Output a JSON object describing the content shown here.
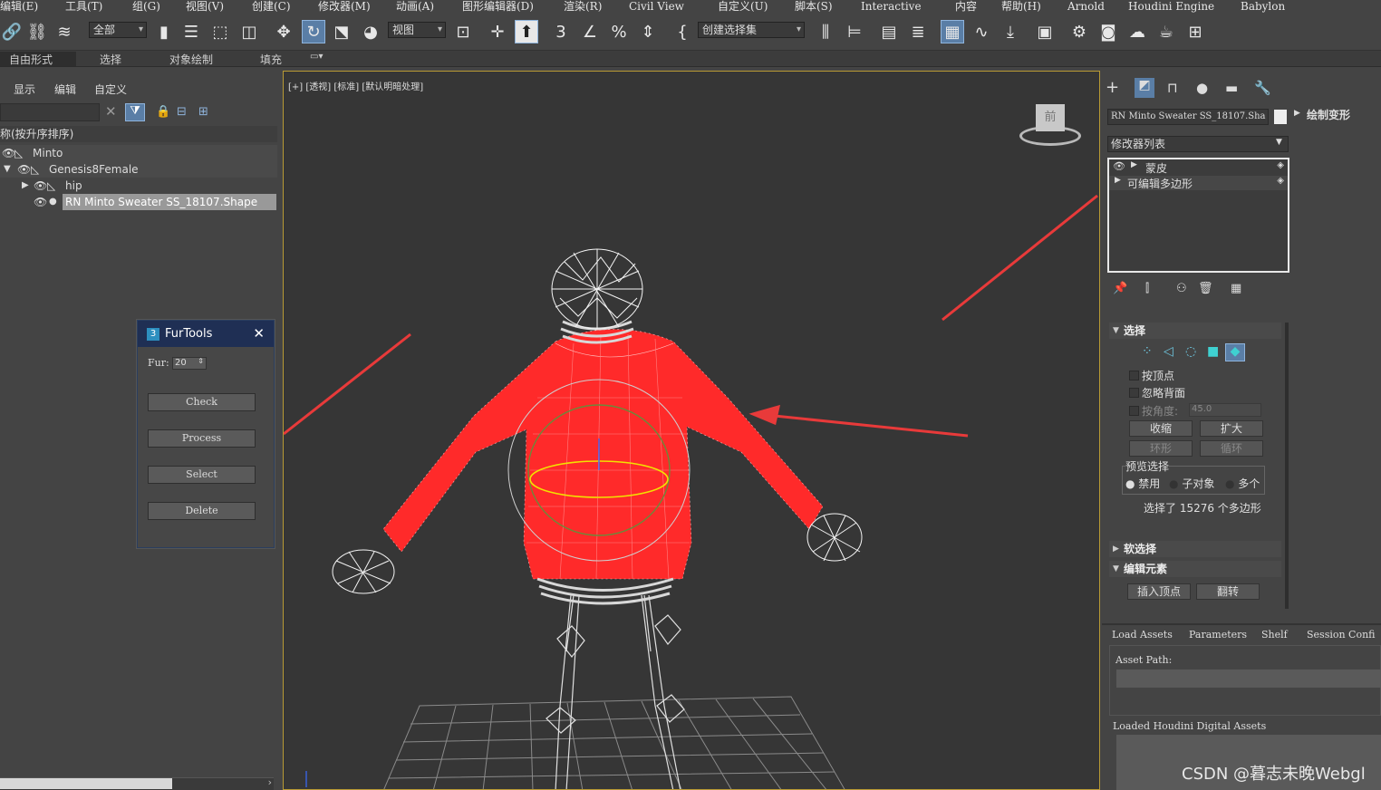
{
  "menu": [
    "编辑(E)",
    "工具(T)",
    "组(G)",
    "视图(V)",
    "创建(C)",
    "修改器(M)",
    "动画(A)",
    "图形编辑器(D)",
    "渲染(R)",
    "Civil View",
    "自定义(U)",
    "脚本(S)",
    "Interactive",
    "内容",
    "帮助(H)",
    "Arnold",
    "Houdini Engine",
    "Babylon"
  ],
  "toolbar": {
    "selection_filter": "全部",
    "ref_coord": "视图",
    "named_selection": "创建选择集"
  },
  "ribbon": [
    "自由形式",
    "选择",
    "对象绘制",
    "填充"
  ],
  "scene_explorer": {
    "tabs": [
      "显示",
      "编辑",
      "自定义"
    ],
    "sort_header": "称(按升序排序)",
    "items": [
      {
        "name": "Minto"
      },
      {
        "name": "Genesis8Female"
      },
      {
        "name": "hip"
      },
      {
        "name": "RN Minto Sweater SS_18107.Shape"
      }
    ]
  },
  "viewport": {
    "label": "[+] [透视] [标准] [默认明暗处理]",
    "viewcube_label": "前"
  },
  "furtools": {
    "title": "FurTools",
    "fur_label": "Fur:",
    "fur_value": "20",
    "buttons": [
      "Check",
      "Process",
      "Select",
      "Delete"
    ]
  },
  "command_panel": {
    "object_name": "RN Minto Sweater SS_18107.Sha",
    "modifier_list": "修改器列表",
    "stack": [
      "蒙皮",
      "可编辑多边形"
    ],
    "paint_deform": "绘制变形",
    "selection": {
      "title": "选择",
      "by_vertex": "按顶点",
      "ignore_backfacing": "忽略背面",
      "by_angle": "按角度:",
      "angle_value": "45.0",
      "shrink": "收缩",
      "grow": "扩大",
      "ring": "环形",
      "loop": "循环",
      "preview_title": "预览选择",
      "preview_options": [
        "禁用",
        "子对象",
        "多个"
      ],
      "status": "选择了 15276 个多边形"
    },
    "soft_selection": "软选择",
    "edit_elements": {
      "title": "编辑元素",
      "insert_vertex": "插入顶点",
      "flip": "翻转"
    }
  },
  "houdini": {
    "tabs": [
      "Load Assets",
      "Parameters",
      "Shelf",
      "Session Confi"
    ],
    "asset_path_label": "Asset Path:",
    "loaded_label": "Loaded Houdini Digital Assets"
  },
  "watermark": "CSDN @暮志未晚Webgl",
  "colors": {
    "accent": "#5a7ea6",
    "sweater": "#ff2a2a",
    "arrow": "#e83a3a",
    "viewport_border": "#b89a34"
  }
}
